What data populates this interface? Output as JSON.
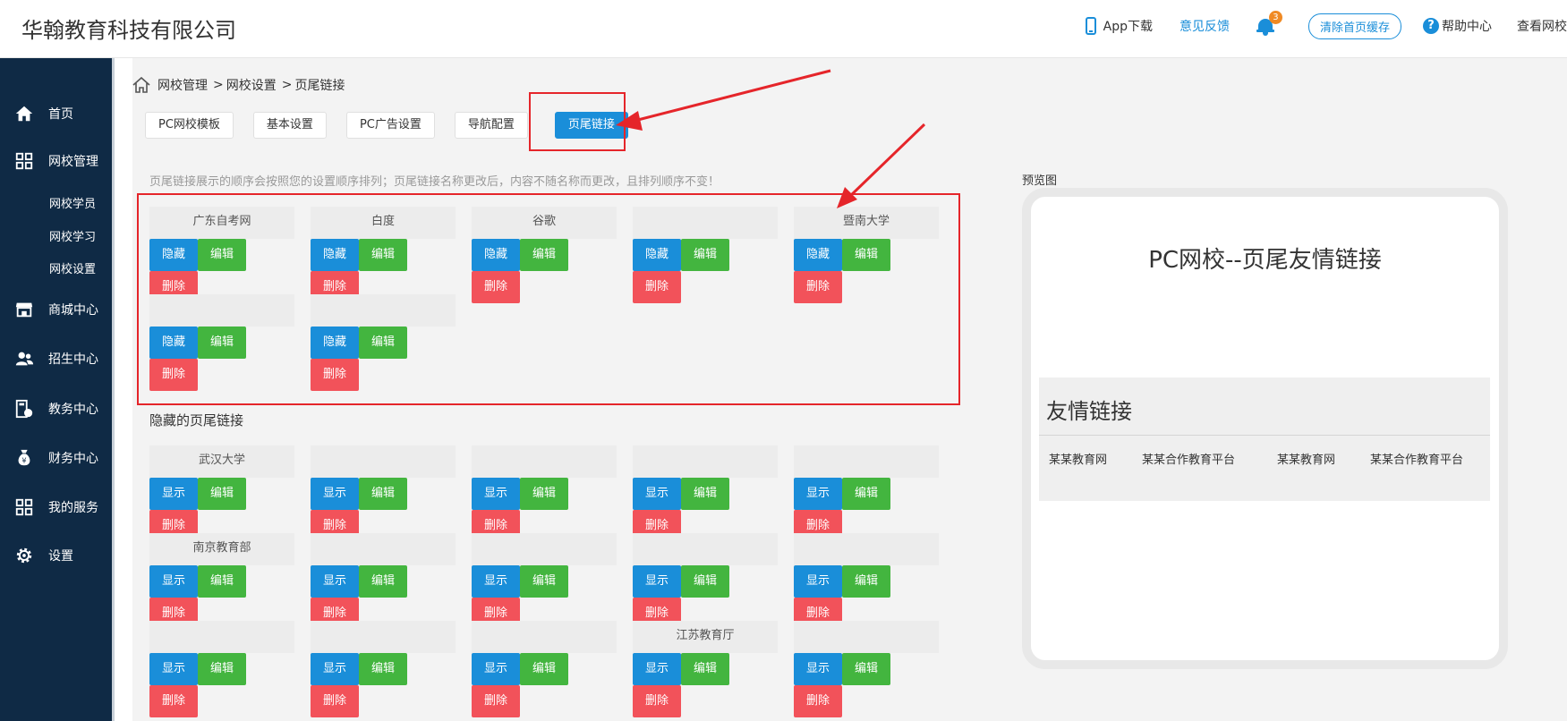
{
  "header": {
    "company": "华翰教育科技有限公司",
    "app_download": "App下载",
    "feedback": "意见反馈",
    "notification_count": "3",
    "clear_cache": "清除首页缓存",
    "help": "帮助中心",
    "view_school": "查看网校"
  },
  "sidebar": {
    "items": [
      {
        "label": "首页",
        "icon": "home-icon"
      },
      {
        "label": "网校管理",
        "icon": "grid-icon"
      },
      {
        "label": "商城中心",
        "icon": "store-icon"
      },
      {
        "label": "招生中心",
        "icon": "users-icon"
      },
      {
        "label": "教务中心",
        "icon": "book-icon"
      },
      {
        "label": "财务中心",
        "icon": "money-bag-icon"
      },
      {
        "label": "我的服务",
        "icon": "grid-icon"
      },
      {
        "label": "设置",
        "icon": "gear-icon"
      }
    ],
    "submenu": [
      "网校学员",
      "网校学习",
      "网校设置"
    ]
  },
  "breadcrumb": [
    "网校管理",
    "网校设置",
    "页尾链接"
  ],
  "tabs": [
    "PC网校模板",
    "基本设置",
    "PC广告设置",
    "导航配置",
    "页尾链接"
  ],
  "active_tab": 4,
  "notice": "页尾链接展示的顺序会按照您的设置顺序排列；页尾链接名称更改后，内容不随名称而更改，且排列顺序不变！",
  "buttons": {
    "hide": "隐藏",
    "show": "显示",
    "edit": "编辑",
    "delete": "删除"
  },
  "visible_links": [
    "广东自考网",
    "白度",
    "谷歌",
    "",
    "暨南大学",
    "",
    ""
  ],
  "hidden_title": "隐藏的页尾链接",
  "hidden_links": [
    "武汉大学",
    "",
    "",
    "",
    "",
    "南京教育部",
    "",
    "",
    "",
    "",
    "",
    "",
    "",
    "江苏教育厅",
    "",
    "",
    "",
    "",
    "",
    ""
  ],
  "preview": {
    "label": "预览图",
    "title": "PC网校--页尾友情链接",
    "section_title": "友情链接",
    "links": [
      "某某教育网",
      "某某合作教育平台",
      "某某教育网",
      "某某合作教育平台"
    ]
  },
  "colors": {
    "sidebar_bg": "#0f2a45",
    "accent_blue": "#1a8ed9",
    "edit_green": "#43b53f",
    "delete_red": "#f2525a",
    "annotation_red": "#e5252a"
  }
}
